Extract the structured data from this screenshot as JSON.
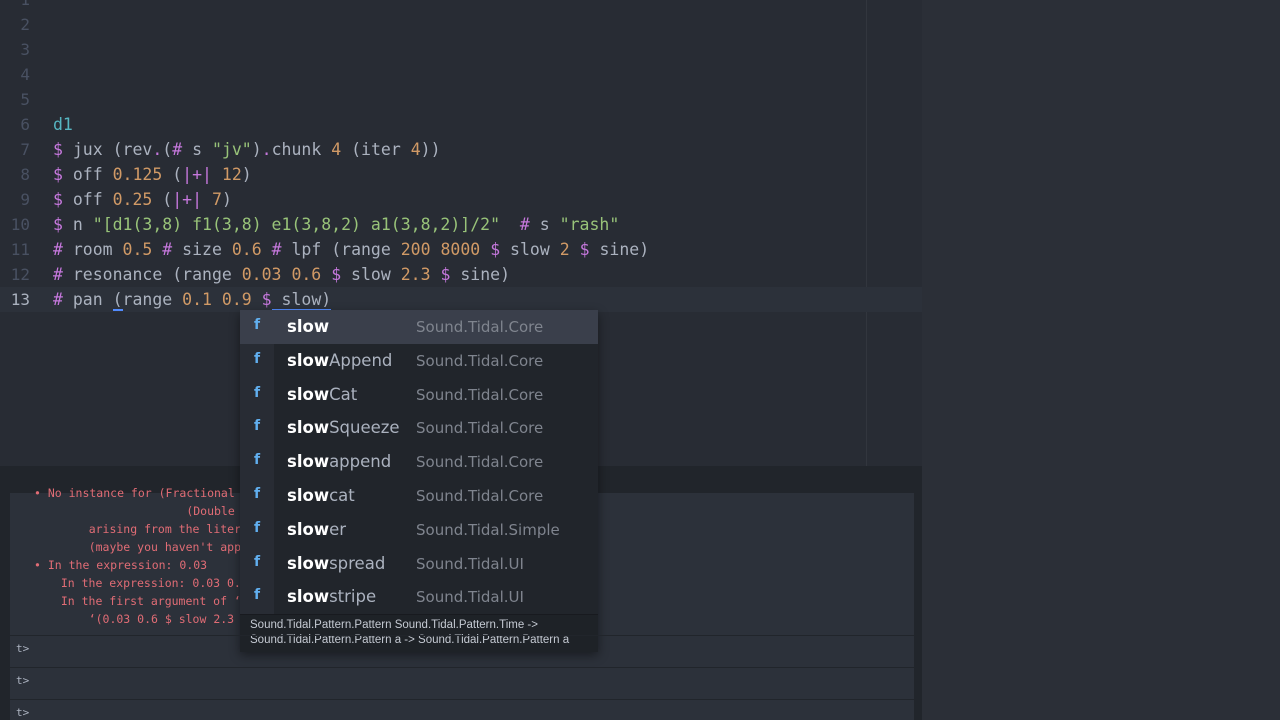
{
  "editor": {
    "lines": [
      {
        "num": "1",
        "segments": []
      },
      {
        "num": "2",
        "segments": []
      },
      {
        "num": "3",
        "segments": []
      },
      {
        "num": "4",
        "segments": []
      },
      {
        "num": "5",
        "segments": []
      },
      {
        "num": "6",
        "segments": [
          {
            "t": "d1",
            "c": "kw-d"
          }
        ]
      },
      {
        "num": "7",
        "segments": [
          {
            "t": "$ ",
            "c": "op"
          },
          {
            "t": "jux (rev",
            "c": "fn"
          },
          {
            "t": ".",
            "c": "op"
          },
          {
            "t": "(",
            "c": "fn"
          },
          {
            "t": "#",
            "c": "op"
          },
          {
            "t": " s ",
            "c": "fn"
          },
          {
            "t": "\"jv\"",
            "c": "str"
          },
          {
            "t": ")",
            "c": "fn"
          },
          {
            "t": ".",
            "c": "op"
          },
          {
            "t": "chunk ",
            "c": "fn"
          },
          {
            "t": "4",
            "c": "num"
          },
          {
            "t": " (iter ",
            "c": "fn"
          },
          {
            "t": "4",
            "c": "num"
          },
          {
            "t": "))",
            "c": "fn"
          }
        ]
      },
      {
        "num": "8",
        "segments": [
          {
            "t": "$ ",
            "c": "op"
          },
          {
            "t": "off ",
            "c": "fn"
          },
          {
            "t": "0.125",
            "c": "num"
          },
          {
            "t": " (",
            "c": "fn"
          },
          {
            "t": "|+|",
            "c": "op"
          },
          {
            "t": " ",
            "c": "fn"
          },
          {
            "t": "12",
            "c": "num"
          },
          {
            "t": ")",
            "c": "fn"
          }
        ]
      },
      {
        "num": "9",
        "segments": [
          {
            "t": "$ ",
            "c": "op"
          },
          {
            "t": "off ",
            "c": "fn"
          },
          {
            "t": "0.25",
            "c": "num"
          },
          {
            "t": " (",
            "c": "fn"
          },
          {
            "t": "|+|",
            "c": "op"
          },
          {
            "t": " ",
            "c": "fn"
          },
          {
            "t": "7",
            "c": "num"
          },
          {
            "t": ")",
            "c": "fn"
          }
        ]
      },
      {
        "num": "10",
        "segments": [
          {
            "t": "$ ",
            "c": "op"
          },
          {
            "t": "n ",
            "c": "fn"
          },
          {
            "t": "\"[d1(3,8) f1(3,8) e1(3,8,2) a1(3,8,2)]/2\"",
            "c": "str"
          },
          {
            "t": "  ",
            "c": "fn"
          },
          {
            "t": "#",
            "c": "op"
          },
          {
            "t": " s ",
            "c": "fn"
          },
          {
            "t": "\"rash\"",
            "c": "str"
          }
        ]
      },
      {
        "num": "11",
        "segments": [
          {
            "t": "#",
            "c": "op"
          },
          {
            "t": " room ",
            "c": "fn"
          },
          {
            "t": "0.5",
            "c": "num"
          },
          {
            "t": " ",
            "c": "fn"
          },
          {
            "t": "#",
            "c": "op"
          },
          {
            "t": " size ",
            "c": "fn"
          },
          {
            "t": "0.6",
            "c": "num"
          },
          {
            "t": " ",
            "c": "fn"
          },
          {
            "t": "#",
            "c": "op"
          },
          {
            "t": " lpf (range ",
            "c": "fn"
          },
          {
            "t": "200",
            "c": "num"
          },
          {
            "t": " ",
            "c": "fn"
          },
          {
            "t": "8000",
            "c": "num"
          },
          {
            "t": " ",
            "c": "fn"
          },
          {
            "t": "$",
            "c": "op"
          },
          {
            "t": " slow ",
            "c": "fn"
          },
          {
            "t": "2",
            "c": "num"
          },
          {
            "t": " ",
            "c": "fn"
          },
          {
            "t": "$",
            "c": "op"
          },
          {
            "t": " sine)",
            "c": "fn"
          }
        ]
      },
      {
        "num": "12",
        "segments": [
          {
            "t": "#",
            "c": "op"
          },
          {
            "t": " resonance (range ",
            "c": "fn"
          },
          {
            "t": "0.03",
            "c": "num"
          },
          {
            "t": " ",
            "c": "fn"
          },
          {
            "t": "0.6",
            "c": "num"
          },
          {
            "t": " ",
            "c": "fn"
          },
          {
            "t": "$",
            "c": "op"
          },
          {
            "t": " slow ",
            "c": "fn"
          },
          {
            "t": "2.3",
            "c": "num"
          },
          {
            "t": " ",
            "c": "fn"
          },
          {
            "t": "$",
            "c": "op"
          },
          {
            "t": " sine)",
            "c": "fn"
          }
        ]
      },
      {
        "num": "13",
        "segments": [
          {
            "t": "#",
            "c": "op"
          },
          {
            "t": " pan ",
            "c": "fn"
          },
          {
            "t": "(",
            "c": "fn"
          },
          {
            "t": "range ",
            "c": "fn"
          },
          {
            "t": "0.1",
            "c": "num"
          },
          {
            "t": " ",
            "c": "fn"
          },
          {
            "t": "0.9",
            "c": "num"
          },
          {
            "t": " ",
            "c": "fn"
          },
          {
            "t": "$",
            "c": "op"
          },
          {
            "t": " slow)",
            "c": "fn"
          }
        ]
      }
    ]
  },
  "console": {
    "errors": [
      "• No instance for (Fractional",
      "                      (Double",
      "    arising from the literal",
      "    (maybe you haven't applie",
      "• In the expression: 0.03",
      "  In the expression: 0.03 0.6",
      "  In the first argument of ‘r",
      "    ‘(0.03 0.6 $ slow 2.3 $ s"
    ],
    "prompts": [
      "t>",
      "t>",
      "t>"
    ]
  },
  "autocomplete": {
    "prefix": "slow",
    "items": [
      {
        "type": "f",
        "match": "slow",
        "rest": "",
        "module": "Sound.Tidal.Core"
      },
      {
        "type": "f",
        "match": "slow",
        "rest": "Append",
        "module": "Sound.Tidal.Core"
      },
      {
        "type": "f",
        "match": "slow",
        "rest": "Cat",
        "module": "Sound.Tidal.Core"
      },
      {
        "type": "f",
        "match": "slow",
        "rest": "Squeeze",
        "module": "Sound.Tidal.Core"
      },
      {
        "type": "f",
        "match": "slow",
        "rest": "append",
        "module": "Sound.Tidal.Core"
      },
      {
        "type": "f",
        "match": "slow",
        "rest": "cat",
        "module": "Sound.Tidal.Core"
      },
      {
        "type": "f",
        "match": "slow",
        "rest": "er",
        "module": "Sound.Tidal.Simple"
      },
      {
        "type": "f",
        "match": "slow",
        "rest": "spread",
        "module": "Sound.Tidal.UI"
      },
      {
        "type": "f",
        "match": "slow",
        "rest": "stripe",
        "module": "Sound.Tidal.UI"
      }
    ],
    "description": [
      "Sound.Tidal.Pattern.Pattern Sound.Tidal.Pattern.Time ->",
      "Sound.Tidal.Pattern.Pattern a -> Sound.Tidal.Pattern.Pattern a"
    ]
  }
}
